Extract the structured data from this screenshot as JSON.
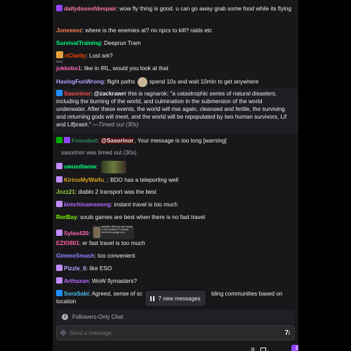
{
  "messages": [
    {
      "user": "dailydoseofdespair",
      "color": "#ff7aa8",
      "text": ": wow fly thing is good. u can go away grab some food while its flying",
      "badge": "#9147ff"
    },
    {
      "user": "Joneeeez",
      "color": "#ff7f50",
      "text": ": where is the enemies at? no npcs to kill? raids etc"
    },
    {
      "user": "SurvivalTraining",
      "color": "#00ff7f",
      "text": ": Deeprun Tram"
    },
    {
      "user": "nClarity",
      "color": "#ff4500",
      "text": ": Lost ark?",
      "badge_label": "2016"
    },
    {
      "user": "jokkebo1",
      "color": "#ff69b4",
      "text": ": like in IRL, would you look at that"
    },
    {
      "user": "HavingFunWrong",
      "color": "#b8a0ff",
      "text_a": ": flight paths",
      "text_b": "spend 10s and wait 10min to get anywhere"
    },
    {
      "user": "Sasorinor",
      "color": "#ff4d4d",
      "mention": "@zackrawrr",
      "text": " this is ragnarok: \"a catastrophic series of natural disasters, including the burning of the world, and culmination in the submersion of the world underwater. After these events, the world will rise again, cleansed and fertile, the surviving and returning gods will meet, and the world will be repopulated by two human survivors, Lif and Lifþrasir.\"",
      "timeout": " —Timed out (30s)"
    },
    {
      "user": "Fossabot",
      "color": "#2e8b57",
      "mention": "@Sasorinor",
      "text": ", Your message is too long [warning]"
    },
    {
      "system": "sasorinor was timed out (30s)"
    },
    {
      "user": "uwuediwow",
      "color": "#00ff7f",
      "text": ":"
    },
    {
      "user": "KirinoMyWaifu_",
      "color": "#daa520",
      "text": ": BDO has a teleporting well"
    },
    {
      "user": "Jozz21",
      "color": "#9acd32",
      "text": ": diablo 2 transport was the best"
    },
    {
      "user": "kimchinamseong",
      "color": "#b36bff",
      "text": ": instant travel is too much"
    },
    {
      "user": "RorBoy",
      "color": "#7fff00",
      "text": ": souls games are best when there is no fast travel"
    },
    {
      "user": "Sylas420",
      "color": "#ff69b4",
      "text": ":",
      "meme": "actually i think you are wrong in this instance if u simply check the google.com"
    },
    {
      "user": "EZIO801",
      "color": "#ff5fa8",
      "text": ": er fast travel is too much"
    },
    {
      "user": "GimmeSmash",
      "color": "#8a8aff",
      "text": ": too convenient"
    },
    {
      "user": "Pizzle_6",
      "color": "#b9a0ff",
      "text": ": like ESO"
    },
    {
      "user": "Arthaxan",
      "color": "#b36bff",
      "text": ": WoW flymasters?"
    },
    {
      "user": "SoraSabi",
      "color": "#4fc3f7",
      "text_a": ": Agreed, sense of sc",
      "text_b": "lding communities based on location"
    }
  ],
  "new_messages": "7 new messages",
  "followers_only": "Followers-Only Chat",
  "input_placeholder": "Send a message",
  "chat_button": "Chat",
  "colors": {
    "accent": "#9147ff",
    "panel": "#18181b"
  }
}
